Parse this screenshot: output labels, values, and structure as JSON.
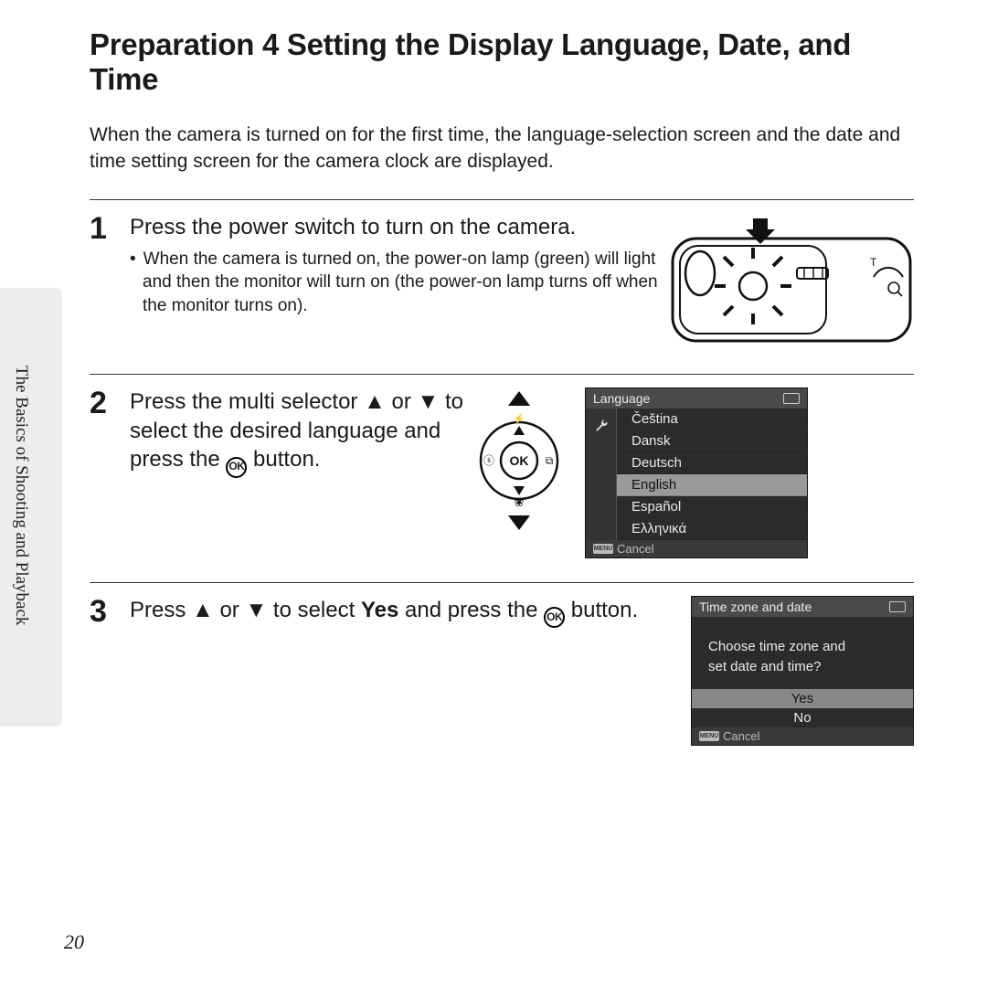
{
  "title": "Preparation 4 Setting the Display Language, Date, and Time",
  "side_title": "The Basics of Shooting and Playback",
  "intro": "When the camera is turned on for the first time, the language-selection screen and the date and time setting screen for the camera clock are displayed.",
  "steps": {
    "s1": {
      "num": "1",
      "head": "Press the power switch to turn on the camera.",
      "sub": "When the camera is turned on, the power-on lamp (green) will light and then the monitor will turn on (the power-on lamp turns off when the monitor turns on)."
    },
    "s2": {
      "num": "2",
      "head_a": "Press the multi selector ",
      "head_b": " or ",
      "head_c": " to select the desired language and press the ",
      "head_d": " button."
    },
    "s3": {
      "num": "3",
      "head_a": "Press ",
      "head_b": " or ",
      "head_c": " to select ",
      "head_yes": "Yes",
      "head_d": " and press the ",
      "head_e": " button."
    }
  },
  "ok_label": "OK",
  "lcd_lang": {
    "title": "Language",
    "items": [
      "Čeština",
      "Dansk",
      "Deutsch",
      "English",
      "Español",
      "Ελληνικά"
    ],
    "selected_index": 3,
    "cancel": "Cancel"
  },
  "lcd_tz": {
    "title": "Time zone and date",
    "prompt_l1": "Choose time zone and",
    "prompt_l2": "set date and time?",
    "yes": "Yes",
    "no": "No",
    "cancel": "Cancel"
  },
  "page_number": "20"
}
